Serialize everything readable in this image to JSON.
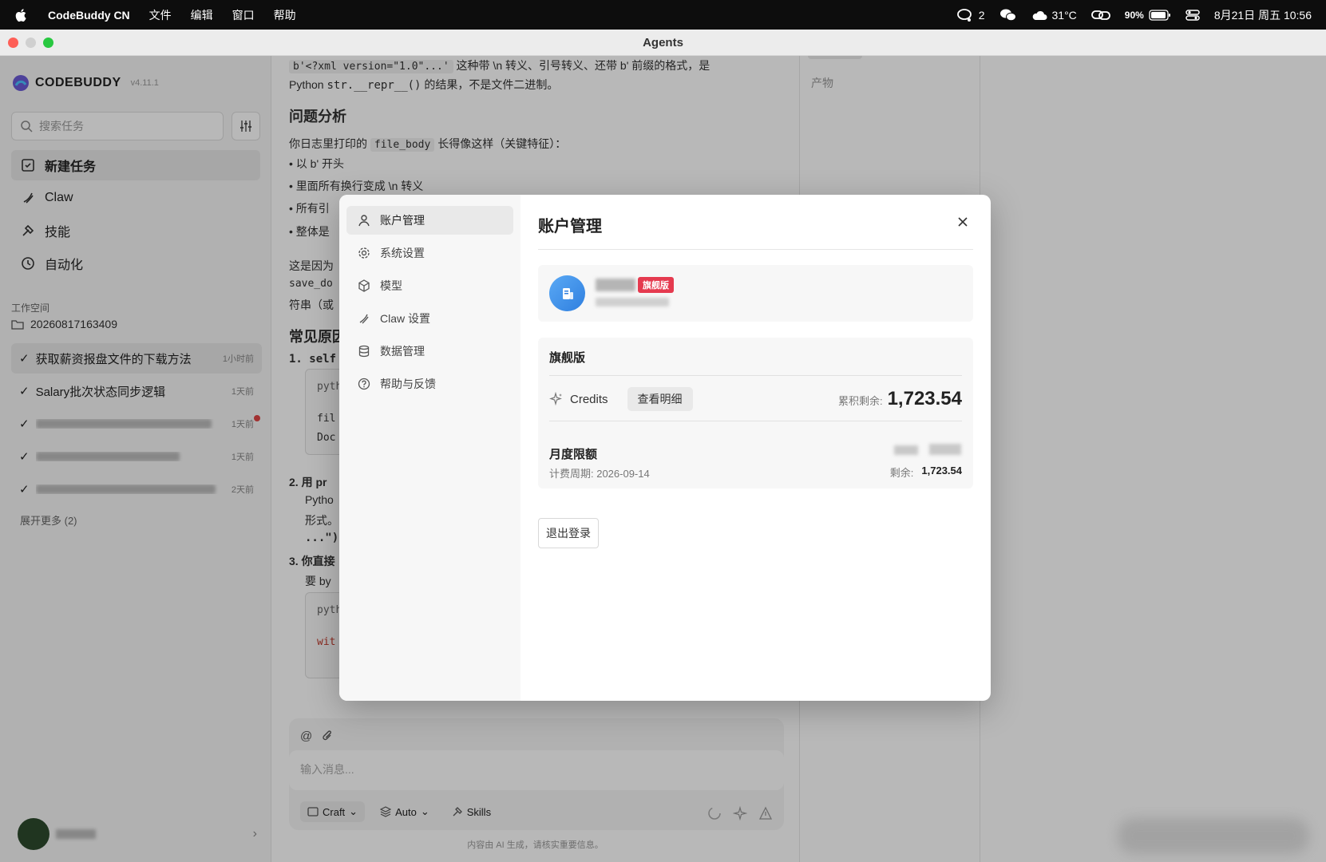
{
  "menubar": {
    "app_name": "CodeBuddy CN",
    "menus": [
      "文件",
      "编辑",
      "窗口",
      "帮助"
    ],
    "chat_count": "2",
    "weather": "31°C",
    "battery": "90%",
    "datetime": "8月21日 周五  10:56"
  },
  "window": {
    "title": "Agents"
  },
  "sidebar": {
    "brand": "CODEBUDDY",
    "version": "v4.11.1",
    "search_placeholder": "搜索任务",
    "nav": [
      {
        "label": "新建任务",
        "icon": "new-task-icon"
      },
      {
        "label": "Claw",
        "icon": "claw-icon"
      },
      {
        "label": "技能",
        "icon": "skills-icon"
      },
      {
        "label": "自动化",
        "icon": "clock-icon"
      }
    ],
    "workspace_label": "工作空间",
    "workspace_folder": "20260817163409",
    "tasks": [
      {
        "name": "获取薪资报盘文件的下载方法",
        "time": "1小时前"
      },
      {
        "name": "Salary批次状态同步逻辑",
        "time": "1天前"
      },
      {
        "name": "",
        "time": "1天前"
      },
      {
        "name": "",
        "time": "1天前"
      },
      {
        "name": "",
        "time": "2天前"
      }
    ],
    "expand_more": "展开更多 (2)"
  },
  "main": {
    "line1_code": "b'<?xml version=\"1.0\"...'",
    "line1_text": " 这种带 \\n 转义、引号转义、还带 b' 前缀的格式，是",
    "line2_code": "str.__repr__()",
    "line2_prefix": "Python ",
    "line2_suffix": " 的结果，不是文件二进制。",
    "heading1": "问题分析",
    "para1_prefix": "你日志里打印的 ",
    "para1_code": "file_body",
    "para1_suffix": " 长得像这样（关键特征）：",
    "bullet1": "以 b' 开头",
    "bullet2": "里面所有换行变成 \\n 转义",
    "bullet3": "所有引",
    "bullet4": "整体是",
    "para2a": "这是因为",
    "para2b": "save_do",
    "para2c": "符串（或",
    "heading2": "常见原因",
    "ol1": "1. self",
    "code1a": "pyth",
    "code1b": "fil",
    "code1c": "Doc",
    "ol2": "2. 用 pr",
    "ol2b": "Pytho",
    "ol2c": "形式。",
    "ol2d": "...\")",
    "ol3": "3. 你直接",
    "ol3b": "要 by",
    "code3a": "pyth",
    "code3b": "wit",
    "composer_placeholder": "输入消息...",
    "mode": "Craft",
    "model": "Auto",
    "skills": "Skills",
    "disclaimer": "内容由 AI 生成，请核实重要信息。"
  },
  "right_panel": {
    "label": "产物"
  },
  "modal": {
    "nav": [
      {
        "label": "账户管理",
        "icon": "user-icon"
      },
      {
        "label": "系统设置",
        "icon": "gear-icon"
      },
      {
        "label": "模型",
        "icon": "cube-icon"
      },
      {
        "label": "Claw 设置",
        "icon": "claw-icon"
      },
      {
        "label": "数据管理",
        "icon": "database-icon"
      },
      {
        "label": "帮助与反馈",
        "icon": "help-icon"
      }
    ],
    "title": "账户管理",
    "badge": "旗舰版",
    "plan_name": "旗舰版",
    "credits_label": "Credits",
    "detail_button": "查看明细",
    "balance_label": "累积剩余:",
    "balance_value": "1,723.54",
    "quota_title": "月度限额",
    "billing_period": "计费周期: 2026-09-14",
    "remain_label": "剩余:",
    "remain_value": "1,723.54",
    "logout": "退出登录"
  }
}
